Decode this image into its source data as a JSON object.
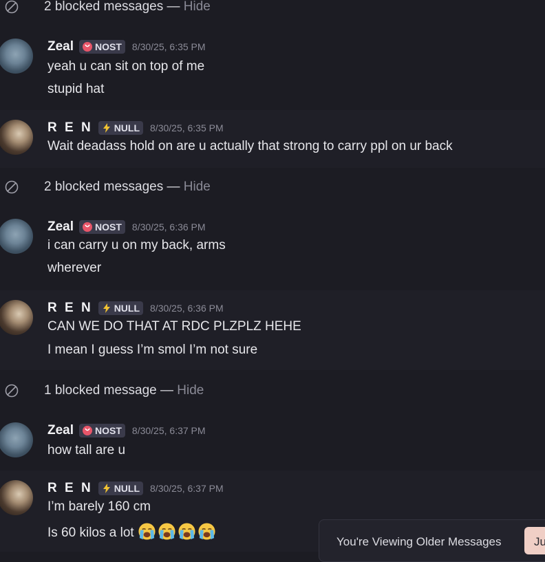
{
  "blocked_groups": [
    {
      "text": "2 blocked messages —",
      "hide": "Hide"
    },
    {
      "text": "2 blocked messages —",
      "hide": "Hide"
    },
    {
      "text": "1 blocked message —",
      "hide": "Hide"
    }
  ],
  "messages": [
    {
      "author": "Zeal",
      "tag": "NOST",
      "time": "8/30/25, 6:35 PM",
      "lines": [
        "yeah u can sit on top of me",
        "stupid hat"
      ]
    },
    {
      "author": "R E N",
      "tag": "NULL",
      "time": "8/30/25, 6:35 PM",
      "lines": [
        "Wait deadass hold on are u actually that strong to carry ppl on ur back"
      ]
    },
    {
      "author": "Zeal",
      "tag": "NOST",
      "time": "8/30/25, 6:36 PM",
      "lines": [
        "i can carry u on my back, arms",
        "wherever"
      ]
    },
    {
      "author": "R E N",
      "tag": "NULL",
      "time": "8/30/25, 6:36 PM",
      "lines": [
        "CAN WE DO THAT AT RDC PLZPLZ HEHE",
        "I mean I guess I’m smol I’m not sure"
      ]
    },
    {
      "author": "Zeal",
      "tag": "NOST",
      "time": "8/30/25, 6:37 PM",
      "lines": [
        "how tall are u"
      ]
    },
    {
      "author": "R E N",
      "tag": "NULL",
      "time": "8/30/25, 6:37 PM",
      "lines": [
        "I’m barely 160 cm",
        "Is 60 kilos a lot"
      ]
    }
  ],
  "emoji": {
    "name": "loudly-crying-face-icon",
    "count": 4
  },
  "older_bar": {
    "label": "You're Viewing Older Messages",
    "jump_label": "Ju"
  },
  "colors": {
    "background": "#1c1c23",
    "tag_bg": "#3a3a4a",
    "nost_icon": "#e8566a",
    "null_icon": "#f0c232",
    "jump_bg": "#f0cfc6"
  }
}
